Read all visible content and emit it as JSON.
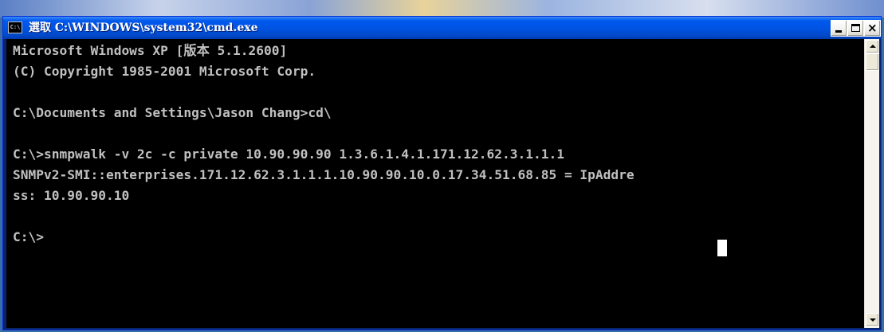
{
  "window": {
    "title": "選取 C:\\WINDOWS\\system32\\cmd.exe",
    "icon_label": "C:\\",
    "icon": "cmd-console-icon",
    "controls": {
      "minimize": "minimize-icon",
      "maximize": "maximize-icon",
      "close_label": "×"
    }
  },
  "console": {
    "background": "#000000",
    "foreground": "#c0c0c0",
    "lines": [
      "Microsoft Windows XP [版本 5.1.2600]",
      "(C) Copyright 1985-2001 Microsoft Corp.",
      "",
      "C:\\Documents and Settings\\Jason Chang>cd\\",
      "",
      "C:\\>snmpwalk -v 2c -c private 10.90.90.90 1.3.6.1.4.1.171.12.62.3.1.1.1",
      "SNMPv2-SMI::enterprises.171.12.62.3.1.1.1.10.90.90.10.0.17.34.51.68.85 = IpAddre",
      "ss: 10.90.90.10",
      "",
      "C:\\>"
    ]
  },
  "colors": {
    "titlebar": "#0054e3",
    "desktop": "#3a6ea5"
  }
}
